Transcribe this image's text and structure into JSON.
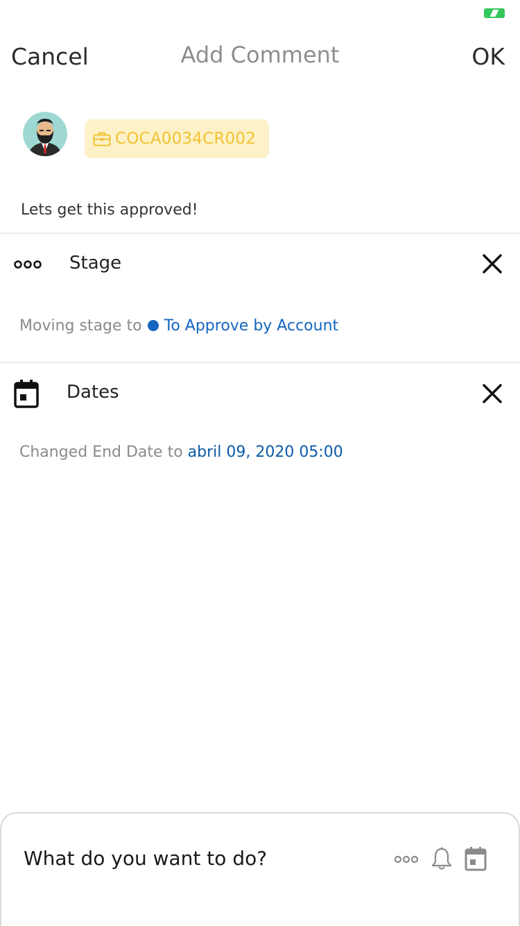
{
  "nav": {
    "cancel_label": "Cancel",
    "title": "Add Comment",
    "ok_label": "OK"
  },
  "record_tag": {
    "code": "COCA0034CR002",
    "icon": "briefcase-icon"
  },
  "comment": {
    "text": "Lets get this approved!"
  },
  "stage_section": {
    "label": "Stage",
    "icon": "three-dots-icon",
    "detail_prefix": "Moving stage to",
    "stage_value": "To Approve by Account"
  },
  "dates_section": {
    "label": "Dates",
    "icon": "calendar-icon",
    "detail_prefix": "Changed End Date to",
    "date_value": "abril 09, 2020 05:00"
  },
  "action_bar": {
    "prompt": "What do you want to do?",
    "icons": [
      "more-icon",
      "bell-icon",
      "calendar-icon"
    ]
  },
  "colors": {
    "tag_bg": "#fdf1c7",
    "tag_text": "#f1c232",
    "link_blue": "#1565c0",
    "battery_green": "#34c759"
  }
}
